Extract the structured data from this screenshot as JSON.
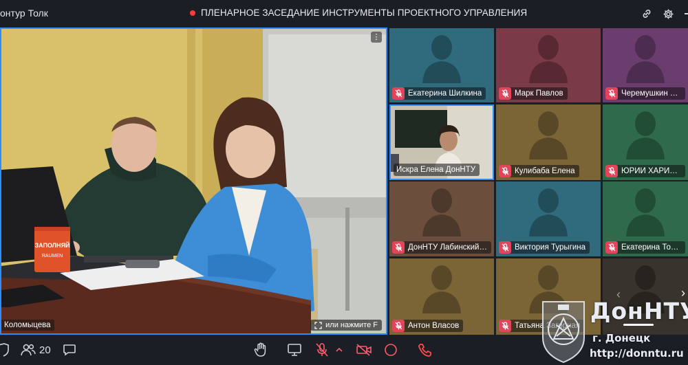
{
  "header": {
    "app_name": "онтур Толк",
    "meeting_title": "ПЛЕНАРНОЕ ЗАСЕДАНИЕ ИНСТРУМЕНТЫ ПРОЕКТНОГО УПРАВЛЕНИЯ",
    "icons": [
      "link-icon",
      "gear-icon"
    ]
  },
  "main_video": {
    "participant_name": "Коломыцева",
    "hint": "или нажмите F",
    "mug_text": "ЗАПОЛНЯЙ",
    "mug_subtext": "RAUMEN"
  },
  "participants": [
    {
      "name": "Екатерина Шилкина",
      "color": "#2f6b7c",
      "muted": true
    },
    {
      "name": "Марк Павлов",
      "color": "#7a3a47",
      "muted": true
    },
    {
      "name": "Черемушкин Егор",
      "color": "#6a3d6e",
      "muted": true
    },
    {
      "name": "Искра Елена ДонНТУ",
      "color": "#c9c4b4",
      "muted": false,
      "live": true
    },
    {
      "name": "Кулибаба Елена",
      "color": "#7b6536",
      "muted": true
    },
    {
      "name": "ЮРИЙ ХАРИТОНОВ",
      "color": "#2e6a4b",
      "muted": true
    },
    {
      "name": "ДонНТУ Лабинский ...",
      "color": "#6b4f3c",
      "muted": true
    },
    {
      "name": "Виктория Турыгина",
      "color": "#2f6b7c",
      "muted": true
    },
    {
      "name": "Екатерина Топалова",
      "color": "#2e6a4b",
      "muted": true
    },
    {
      "name": "Антон Власов",
      "color": "#7b6536",
      "muted": true
    },
    {
      "name": "Татьяна Загорная",
      "color": "#7b6536",
      "muted": true
    }
  ],
  "toolbar": {
    "participants_count": "20",
    "icons": [
      "shield-icon",
      "participants-icon",
      "chat-icon",
      "raise-hand-icon",
      "screen-share-icon",
      "microphone-off-icon",
      "chevron-up-icon",
      "camera-off-icon",
      "record-icon",
      "hang-up-icon"
    ]
  },
  "watermark": {
    "brand": "ДонНТУ",
    "city": "г. Донецк",
    "url": "http://donntu.ru"
  },
  "colors": {
    "background": "#1b1e25",
    "accent": "#2d8cff",
    "muted_badge": "#e0455b",
    "record_dot": "#ff3b3b",
    "hang_up": "#ff4d4d"
  }
}
